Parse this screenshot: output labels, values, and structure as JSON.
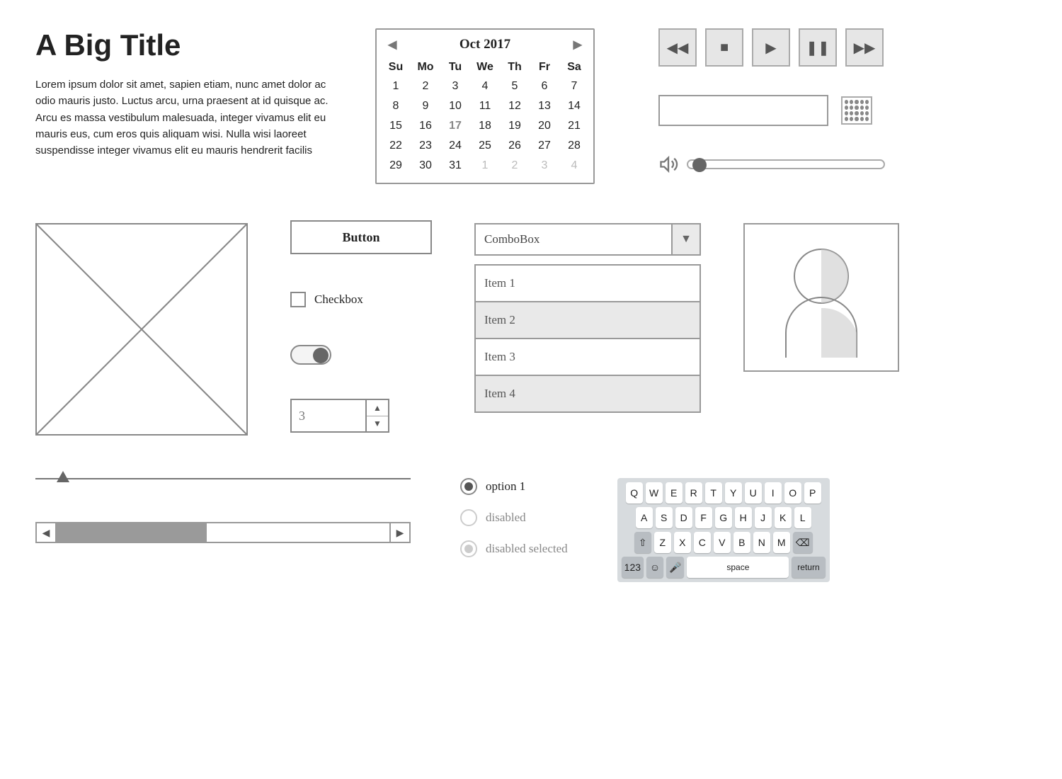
{
  "title": "A Big Title",
  "body_text": "Lorem ipsum dolor sit amet, sapien etiam, nunc amet dolor ac odio mauris justo. Luctus arcu, urna praesent at id quisque ac. Arcu es massa vestibulum malesuada, integer vivamus elit eu mauris eus, cum eros quis aliquam wisi. Nulla wisi laoreet suspendisse integer vivamus elit eu mauris hendrerit facilis",
  "calendar": {
    "month_label": "Oct  2017",
    "dow": [
      "Su",
      "Mo",
      "Tu",
      "We",
      "Th",
      "Fr",
      "Sa"
    ],
    "days": [
      {
        "n": "1"
      },
      {
        "n": "2"
      },
      {
        "n": "3"
      },
      {
        "n": "4"
      },
      {
        "n": "5"
      },
      {
        "n": "6"
      },
      {
        "n": "7"
      },
      {
        "n": "8"
      },
      {
        "n": "9"
      },
      {
        "n": "10"
      },
      {
        "n": "11"
      },
      {
        "n": "12"
      },
      {
        "n": "13"
      },
      {
        "n": "14"
      },
      {
        "n": "15"
      },
      {
        "n": "16"
      },
      {
        "n": "17",
        "sel": true
      },
      {
        "n": "18"
      },
      {
        "n": "19"
      },
      {
        "n": "20"
      },
      {
        "n": "21"
      },
      {
        "n": "22"
      },
      {
        "n": "23"
      },
      {
        "n": "24"
      },
      {
        "n": "25"
      },
      {
        "n": "26"
      },
      {
        "n": "27"
      },
      {
        "n": "28"
      },
      {
        "n": "29"
      },
      {
        "n": "30"
      },
      {
        "n": "31"
      },
      {
        "n": "1",
        "grey": true
      },
      {
        "n": "2",
        "grey": true
      },
      {
        "n": "3",
        "grey": true
      },
      {
        "n": "4",
        "grey": true
      }
    ]
  },
  "button_label": "Button",
  "checkbox_label": "Checkbox",
  "numeric_value": "3",
  "combo_label": "ComboBox",
  "list_items": [
    "Item 1",
    "Item 2",
    "Item 3",
    "Item 4"
  ],
  "radios": {
    "opt1": "option 1",
    "opt2": "disabled",
    "opt3": "disabled selected"
  },
  "keyboard": {
    "row1": [
      "Q",
      "W",
      "E",
      "R",
      "T",
      "Y",
      "U",
      "I",
      "O",
      "P"
    ],
    "row2": [
      "A",
      "S",
      "D",
      "F",
      "G",
      "H",
      "J",
      "K",
      "L"
    ],
    "row3": [
      "Z",
      "X",
      "C",
      "V",
      "B",
      "N",
      "M"
    ],
    "num_key": "123",
    "space_label": "space",
    "return_label": "return"
  }
}
